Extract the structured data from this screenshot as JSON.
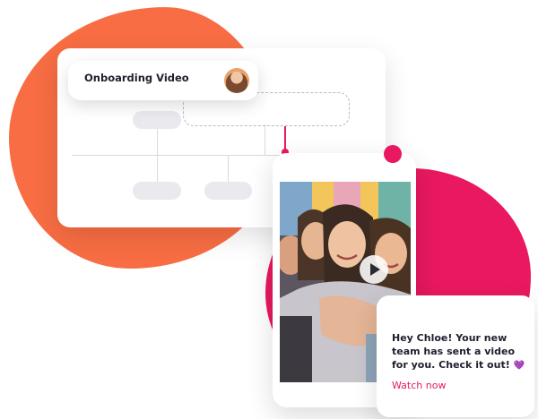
{
  "workflow": {
    "title": "Onboarding Video",
    "avatar_icon": "user-avatar-woman"
  },
  "message": {
    "text": "Hey Chloe! Your new team has sent a video for you. Check it out!",
    "emoji": "💜",
    "link_label": "Watch now"
  },
  "video": {
    "play_icon": "play-icon"
  },
  "colors": {
    "orange_blob": "#f86d43",
    "pink_accent": "#e91861",
    "node_gray": "#e9e9ee"
  }
}
